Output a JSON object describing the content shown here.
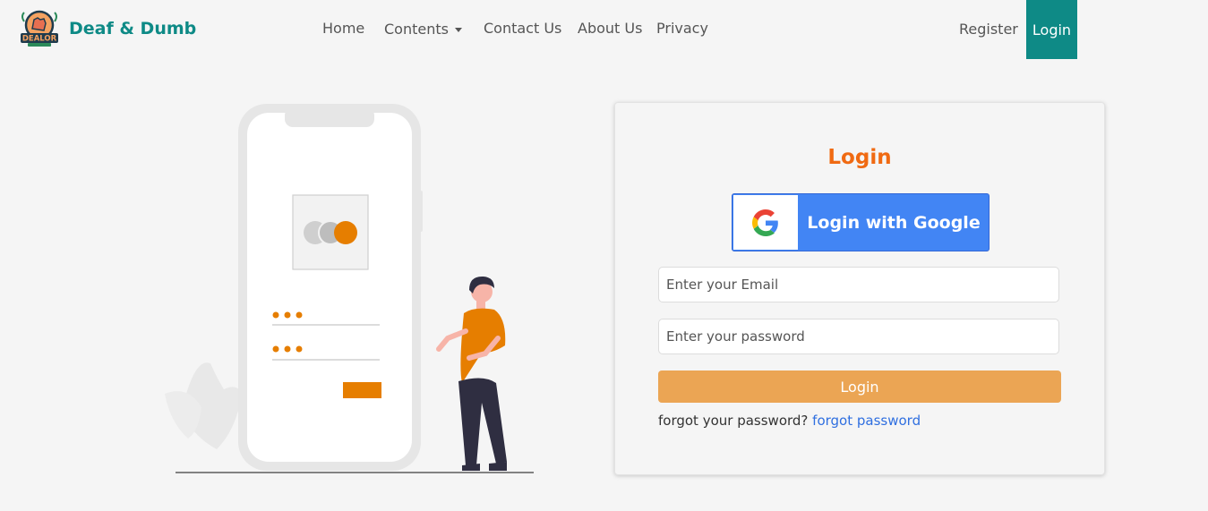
{
  "brand": {
    "name": "Deaf & Dumb",
    "logo_text": "DEALOR"
  },
  "nav": {
    "home": "Home",
    "contents": "Contents",
    "contact": "Contact Us",
    "about": "About Us",
    "privacy": "Privacy",
    "register": "Register",
    "login": "Login"
  },
  "login_card": {
    "title": "Login",
    "google_button": "Login with Google",
    "email_placeholder": "Enter your Email",
    "password_placeholder": "Enter your password",
    "submit_button": "Login",
    "forgot_text": "forgot your password?",
    "forgot_link": "forgot password"
  },
  "colors": {
    "brand_teal": "#0e8a86",
    "title_orange": "#f06a12",
    "google_blue": "#4285f4",
    "submit_orange": "#eba554",
    "link_blue": "#2f6fe0"
  }
}
